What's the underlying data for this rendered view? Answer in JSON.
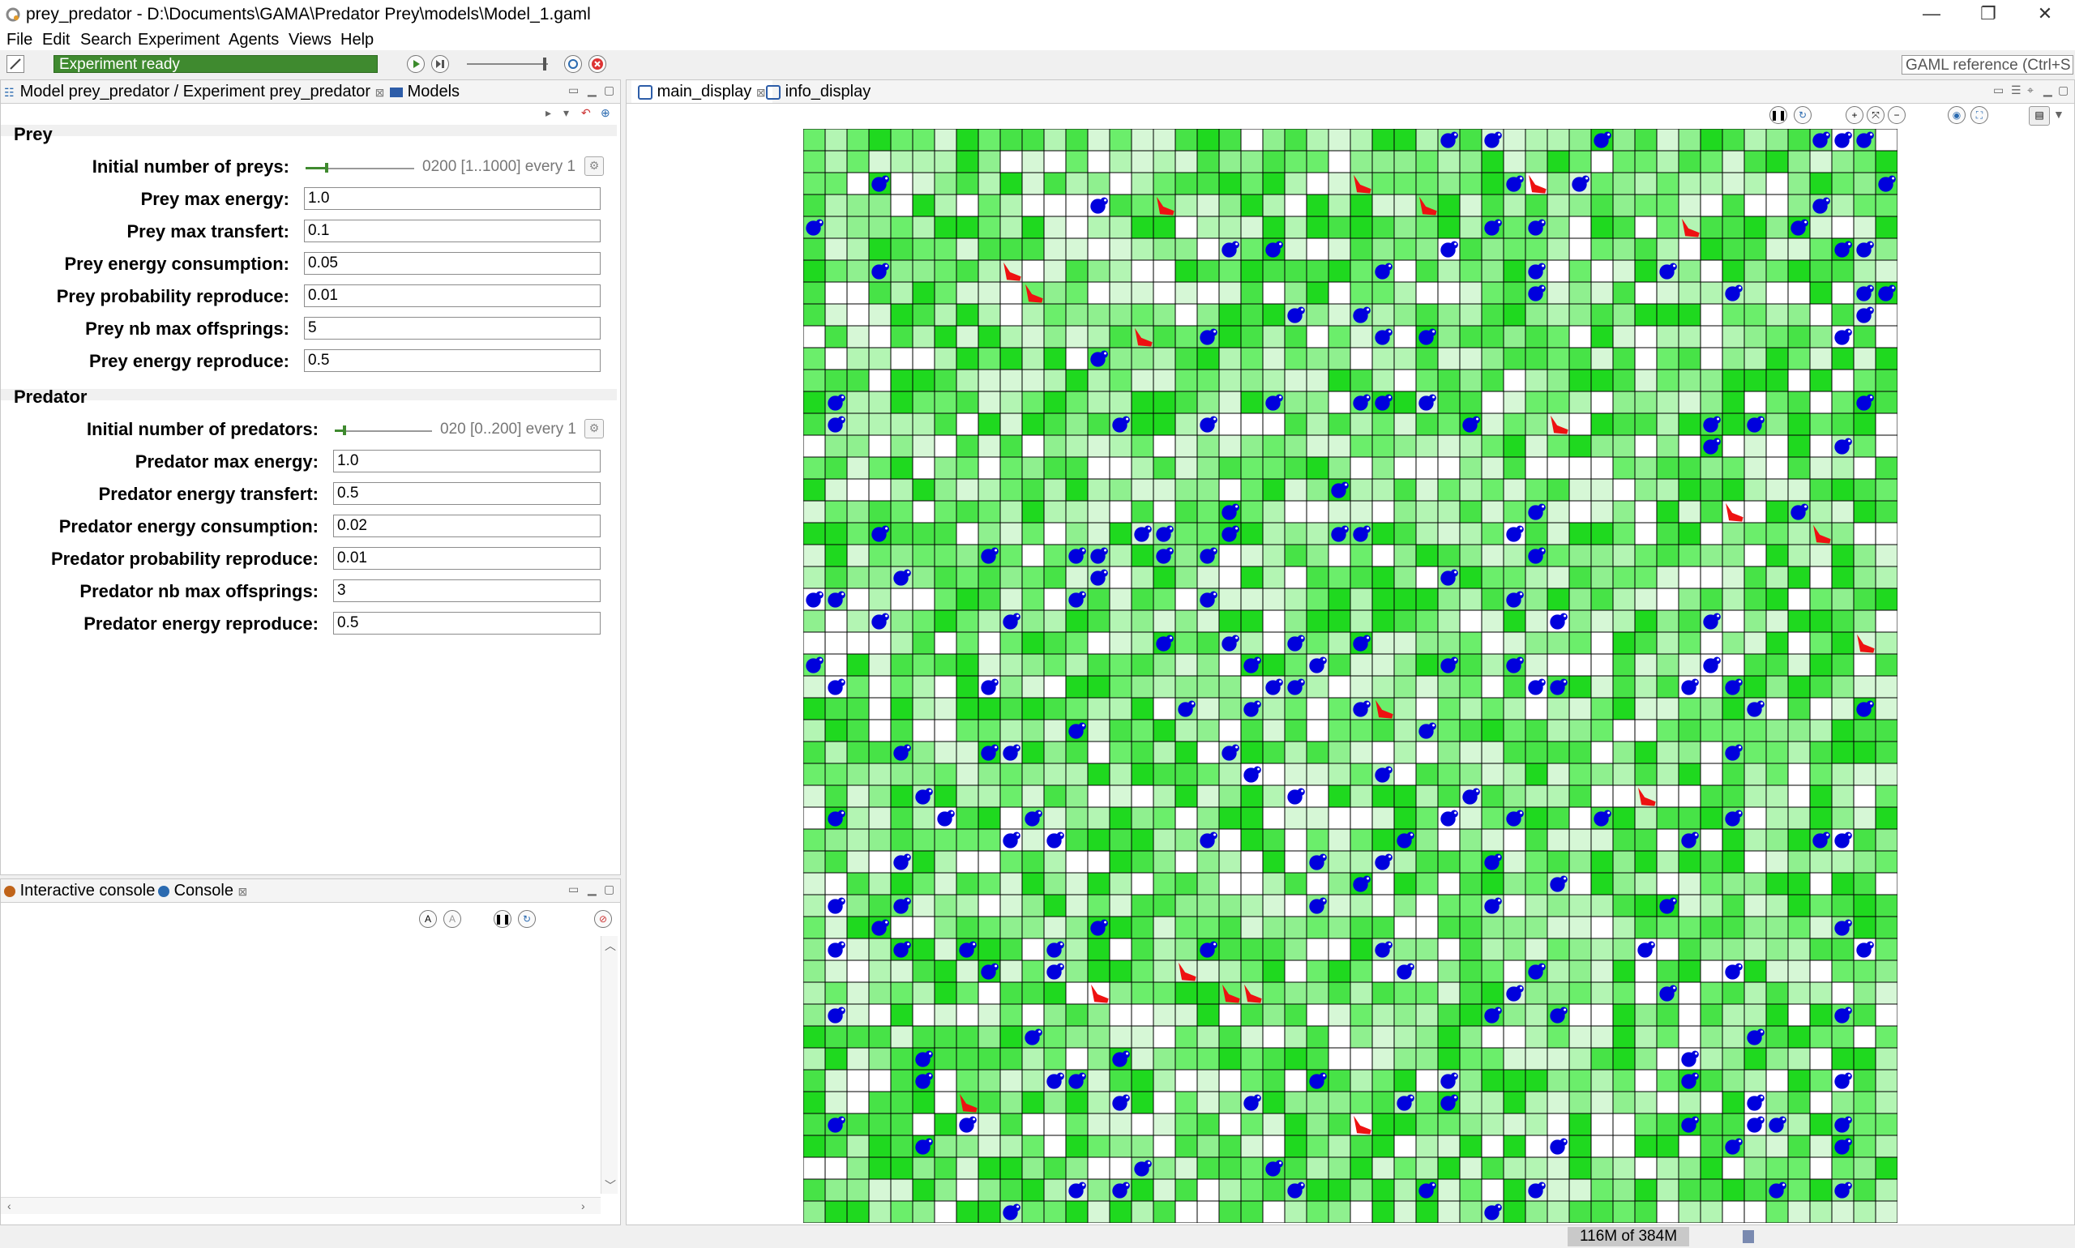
{
  "window": {
    "title": "prey_predator - D:\\Documents\\GAMA\\Predator Prey\\models\\Model_1.gaml",
    "min": "—",
    "restore": "❐",
    "close": "✕"
  },
  "menu": [
    "File",
    "Edit",
    "Search",
    "Experiment",
    "Agents",
    "Views",
    "Help"
  ],
  "toolbar": {
    "status": "Experiment ready",
    "gaml_reference": "GAML reference (Ctrl+S",
    "play_icon": "play-icon",
    "step_icon": "step-icon",
    "reload_icon": "reload-icon",
    "stop_icon": "stop-icon"
  },
  "param_panel": {
    "tab_label": "Model prey_predator / Experiment prey_predator",
    "models_tab": "Models",
    "prey_title": "Prey",
    "predator_title": "Predator",
    "prey": {
      "initial_label": "Initial number of preys:",
      "initial_slider_text": "0200 [1..1000] every 1",
      "initial_value": 200,
      "initial_min": 1,
      "initial_max": 1000,
      "params": [
        {
          "label": "Prey max energy:",
          "value": "1.0"
        },
        {
          "label": "Prey max transfert:",
          "value": "0.1"
        },
        {
          "label": "Prey energy consumption:",
          "value": "0.05"
        },
        {
          "label": "Prey probability reproduce:",
          "value": "0.01"
        },
        {
          "label": "Prey nb max offsprings:",
          "value": "5"
        },
        {
          "label": "Prey energy reproduce:",
          "value": "0.5"
        }
      ]
    },
    "predator": {
      "initial_label": "Initial number of predators:",
      "initial_slider_text": "020 [0..200] every 1",
      "initial_value": 20,
      "initial_min": 0,
      "initial_max": 200,
      "params": [
        {
          "label": "Predator max energy:",
          "value": "1.0"
        },
        {
          "label": "Predator energy transfert:",
          "value": "0.5"
        },
        {
          "label": "Predator energy consumption:",
          "value": "0.02"
        },
        {
          "label": "Predator probability reproduce:",
          "value": "0.01"
        },
        {
          "label": "Predator nb max offsprings:",
          "value": "3"
        },
        {
          "label": "Predator energy reproduce:",
          "value": "0.5"
        }
      ]
    }
  },
  "console_panel": {
    "interactive_tab": "Interactive console",
    "console_tab": "Console"
  },
  "display_panel": {
    "main_tab": "main_display",
    "info_tab": "info_display"
  },
  "simulation": {
    "grid_cols": 50,
    "grid_rows": 50,
    "cell_colors": [
      "#ffffff",
      "#d6f7d6",
      "#b3f5b3",
      "#8ff08f",
      "#6bee6b",
      "#47e347",
      "#1fd91f"
    ],
    "prey_color": "#0000dd",
    "predator_color": "#ee1111",
    "prey_count": 200,
    "predator_count": 20
  },
  "memory": "116M of 384M"
}
